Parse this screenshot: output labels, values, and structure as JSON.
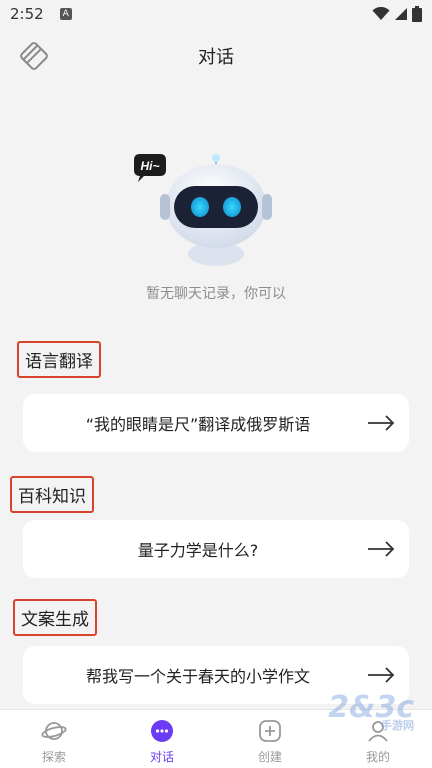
{
  "status": {
    "time": "2:52",
    "indicator": "A"
  },
  "header": {
    "title": "对话"
  },
  "empty_state": {
    "text": "暂无聊天记录，你可以",
    "bubble": "Hi~"
  },
  "sections": [
    {
      "label": "语言翻译",
      "prompt": "“我的眼睛是尺”翻译成俄罗斯语"
    },
    {
      "label": "百科知识",
      "prompt": "量子力学是什么?"
    },
    {
      "label": "文案生成",
      "prompt": "帮我写一个关于春天的小学作文"
    }
  ],
  "tabs": [
    {
      "label": "探索",
      "icon": "planet-icon",
      "active": false
    },
    {
      "label": "对话",
      "icon": "chat-icon",
      "active": true
    },
    {
      "label": "创建",
      "icon": "plus-square-icon",
      "active": false
    },
    {
      "label": "我的",
      "icon": "person-icon",
      "active": false
    }
  ],
  "watermark": {
    "text": "2&3c",
    "sub": "手游网"
  },
  "colors": {
    "accent": "#6a3cf5",
    "highlight_border": "#d8432c",
    "robot_eye": "#39d7ff"
  }
}
